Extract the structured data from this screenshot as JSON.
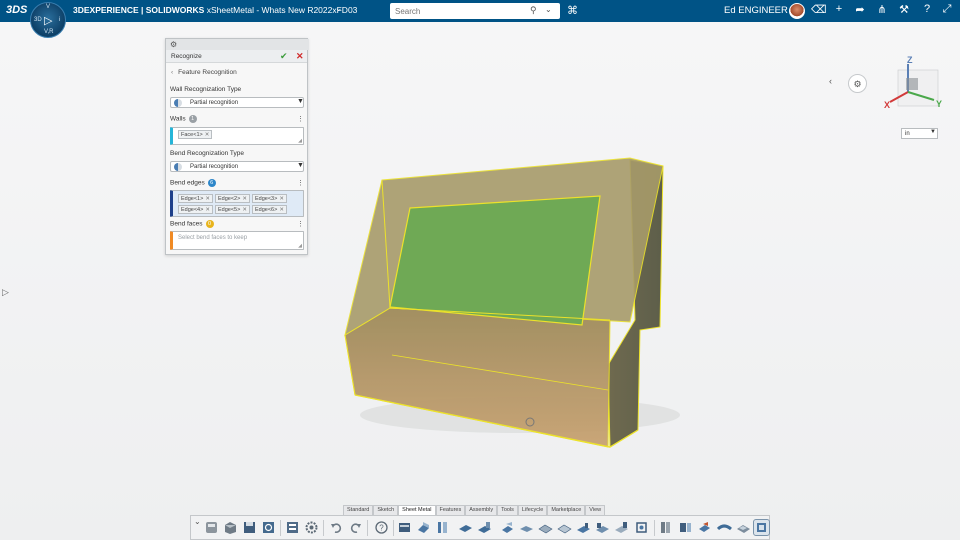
{
  "topbar": {
    "brand_logo": "3DS",
    "compass": {
      "north": "V",
      "south": "V,R",
      "west": "3D",
      "east": "i"
    },
    "title_brand": "3DEXPERIENCE | SOLIDWORKS",
    "title_doc": "xSheetMetal - Whats New R2022xFD03",
    "search": {
      "placeholder": "Search"
    },
    "user_name": "Ed ENGINEER",
    "icons": [
      "bookmark-icon",
      "avatar",
      "feed-icon",
      "add-icon",
      "share-icon",
      "network-icon",
      "tools-icon",
      "help-icon",
      "expand-icon"
    ]
  },
  "panel": {
    "title": "Recognize",
    "section": "Feature Recognition",
    "wall_type": {
      "label": "Wall Recognization Type",
      "value": "Partial recognition"
    },
    "walls": {
      "label": "Walls",
      "count": "1",
      "items": [
        "Face<1>"
      ]
    },
    "bend_type": {
      "label": "Bend Recognization Type",
      "value": "Partial recognition"
    },
    "bend_edges": {
      "label": "Bend edges",
      "count": "6",
      "items": [
        "Edge<1>",
        "Edge<2>",
        "Edge<3>",
        "Edge<4>",
        "Edge<5>",
        "Edge<6>"
      ]
    },
    "bend_faces": {
      "label": "Bend faces",
      "count": "0",
      "placeholder": "Select bend faces to keep"
    }
  },
  "triad": {
    "x": "X",
    "y": "Y",
    "z": "Z"
  },
  "units": {
    "value": "in"
  },
  "command_tabs": [
    "Standard",
    "Sketch",
    "Sheet Metal",
    "Features",
    "Assembly",
    "Tools",
    "Lifecycle",
    "Marketplace",
    "View"
  ],
  "active_tab": "Sheet Metal",
  "colors": {
    "topbar": "#005386",
    "highlight_edges": "#ece22a",
    "model_body": "#c9a36a",
    "selected_face": "#6fb15a"
  }
}
